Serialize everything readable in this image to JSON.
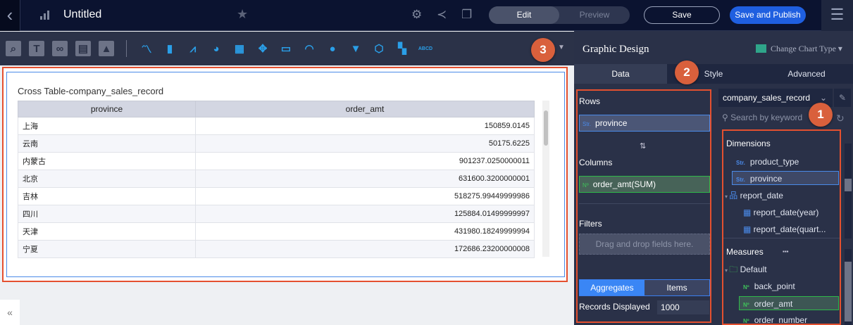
{
  "header": {
    "title": "Untitled",
    "edit": "Edit",
    "preview": "Preview",
    "save": "Save",
    "save_publish": "Save and Publish"
  },
  "toolbar": {
    "tools": [
      "query-control",
      "text",
      "link",
      "tab",
      "image"
    ],
    "charts": [
      "line",
      "bar",
      "combo",
      "pie",
      "table",
      "map",
      "kpi",
      "gauge",
      "bubble",
      "funnel",
      "radar",
      "treemap",
      "word-cloud"
    ]
  },
  "badges": {
    "one": "1",
    "two": "2",
    "three": "3"
  },
  "chart": {
    "title": "Cross Table-company_sales_record",
    "columns": [
      "province",
      "order_amt"
    ],
    "rows": [
      [
        "上海",
        "150859.0145"
      ],
      [
        "云南",
        "50175.6225"
      ],
      [
        "内蒙古",
        "901237.0250000011"
      ],
      [
        "北京",
        "631600.3200000001"
      ],
      [
        "吉林",
        "518275.99449999986"
      ],
      [
        "四川",
        "125884.01499999997"
      ],
      [
        "天津",
        "431980.18249999994"
      ],
      [
        "宁夏",
        "172686.23200000008"
      ]
    ]
  },
  "panel": {
    "title": "Graphic Design",
    "change_chart": "Change Chart Type",
    "tabs": [
      "Data",
      "Style",
      "Advanced"
    ],
    "rows_label": "Rows",
    "row_field": {
      "type": "Str.",
      "name": "province"
    },
    "columns_label": "Columns",
    "column_field": {
      "type": "Nº",
      "name": "order_amt(SUM)"
    },
    "filters_label": "Filters",
    "drop_hint": "Drag and drop fields here.",
    "aggregates": "Aggregates",
    "items": "Items",
    "records_label": "Records Displayed",
    "records_value": "1000",
    "dataset": "company_sales_record",
    "search_placeholder": "Search by keyword",
    "dimensions_label": "Dimensions",
    "measures_label": "Measures",
    "dimensions": [
      {
        "type": "Str.",
        "name": "product_type"
      },
      {
        "type": "Str.",
        "name": "province"
      },
      {
        "type": "",
        "name": "report_date"
      },
      {
        "type": "",
        "name": "report_date(year)"
      },
      {
        "type": "",
        "name": "report_date(quart..."
      }
    ],
    "folder": "Default",
    "measures": [
      {
        "type": "Nº",
        "name": "back_point"
      },
      {
        "type": "Nº",
        "name": "order_amt"
      },
      {
        "type": "Nº",
        "name": "order_number"
      }
    ]
  },
  "colors": {
    "accent": "#1f5fe0",
    "highlight": "#e4502f"
  }
}
